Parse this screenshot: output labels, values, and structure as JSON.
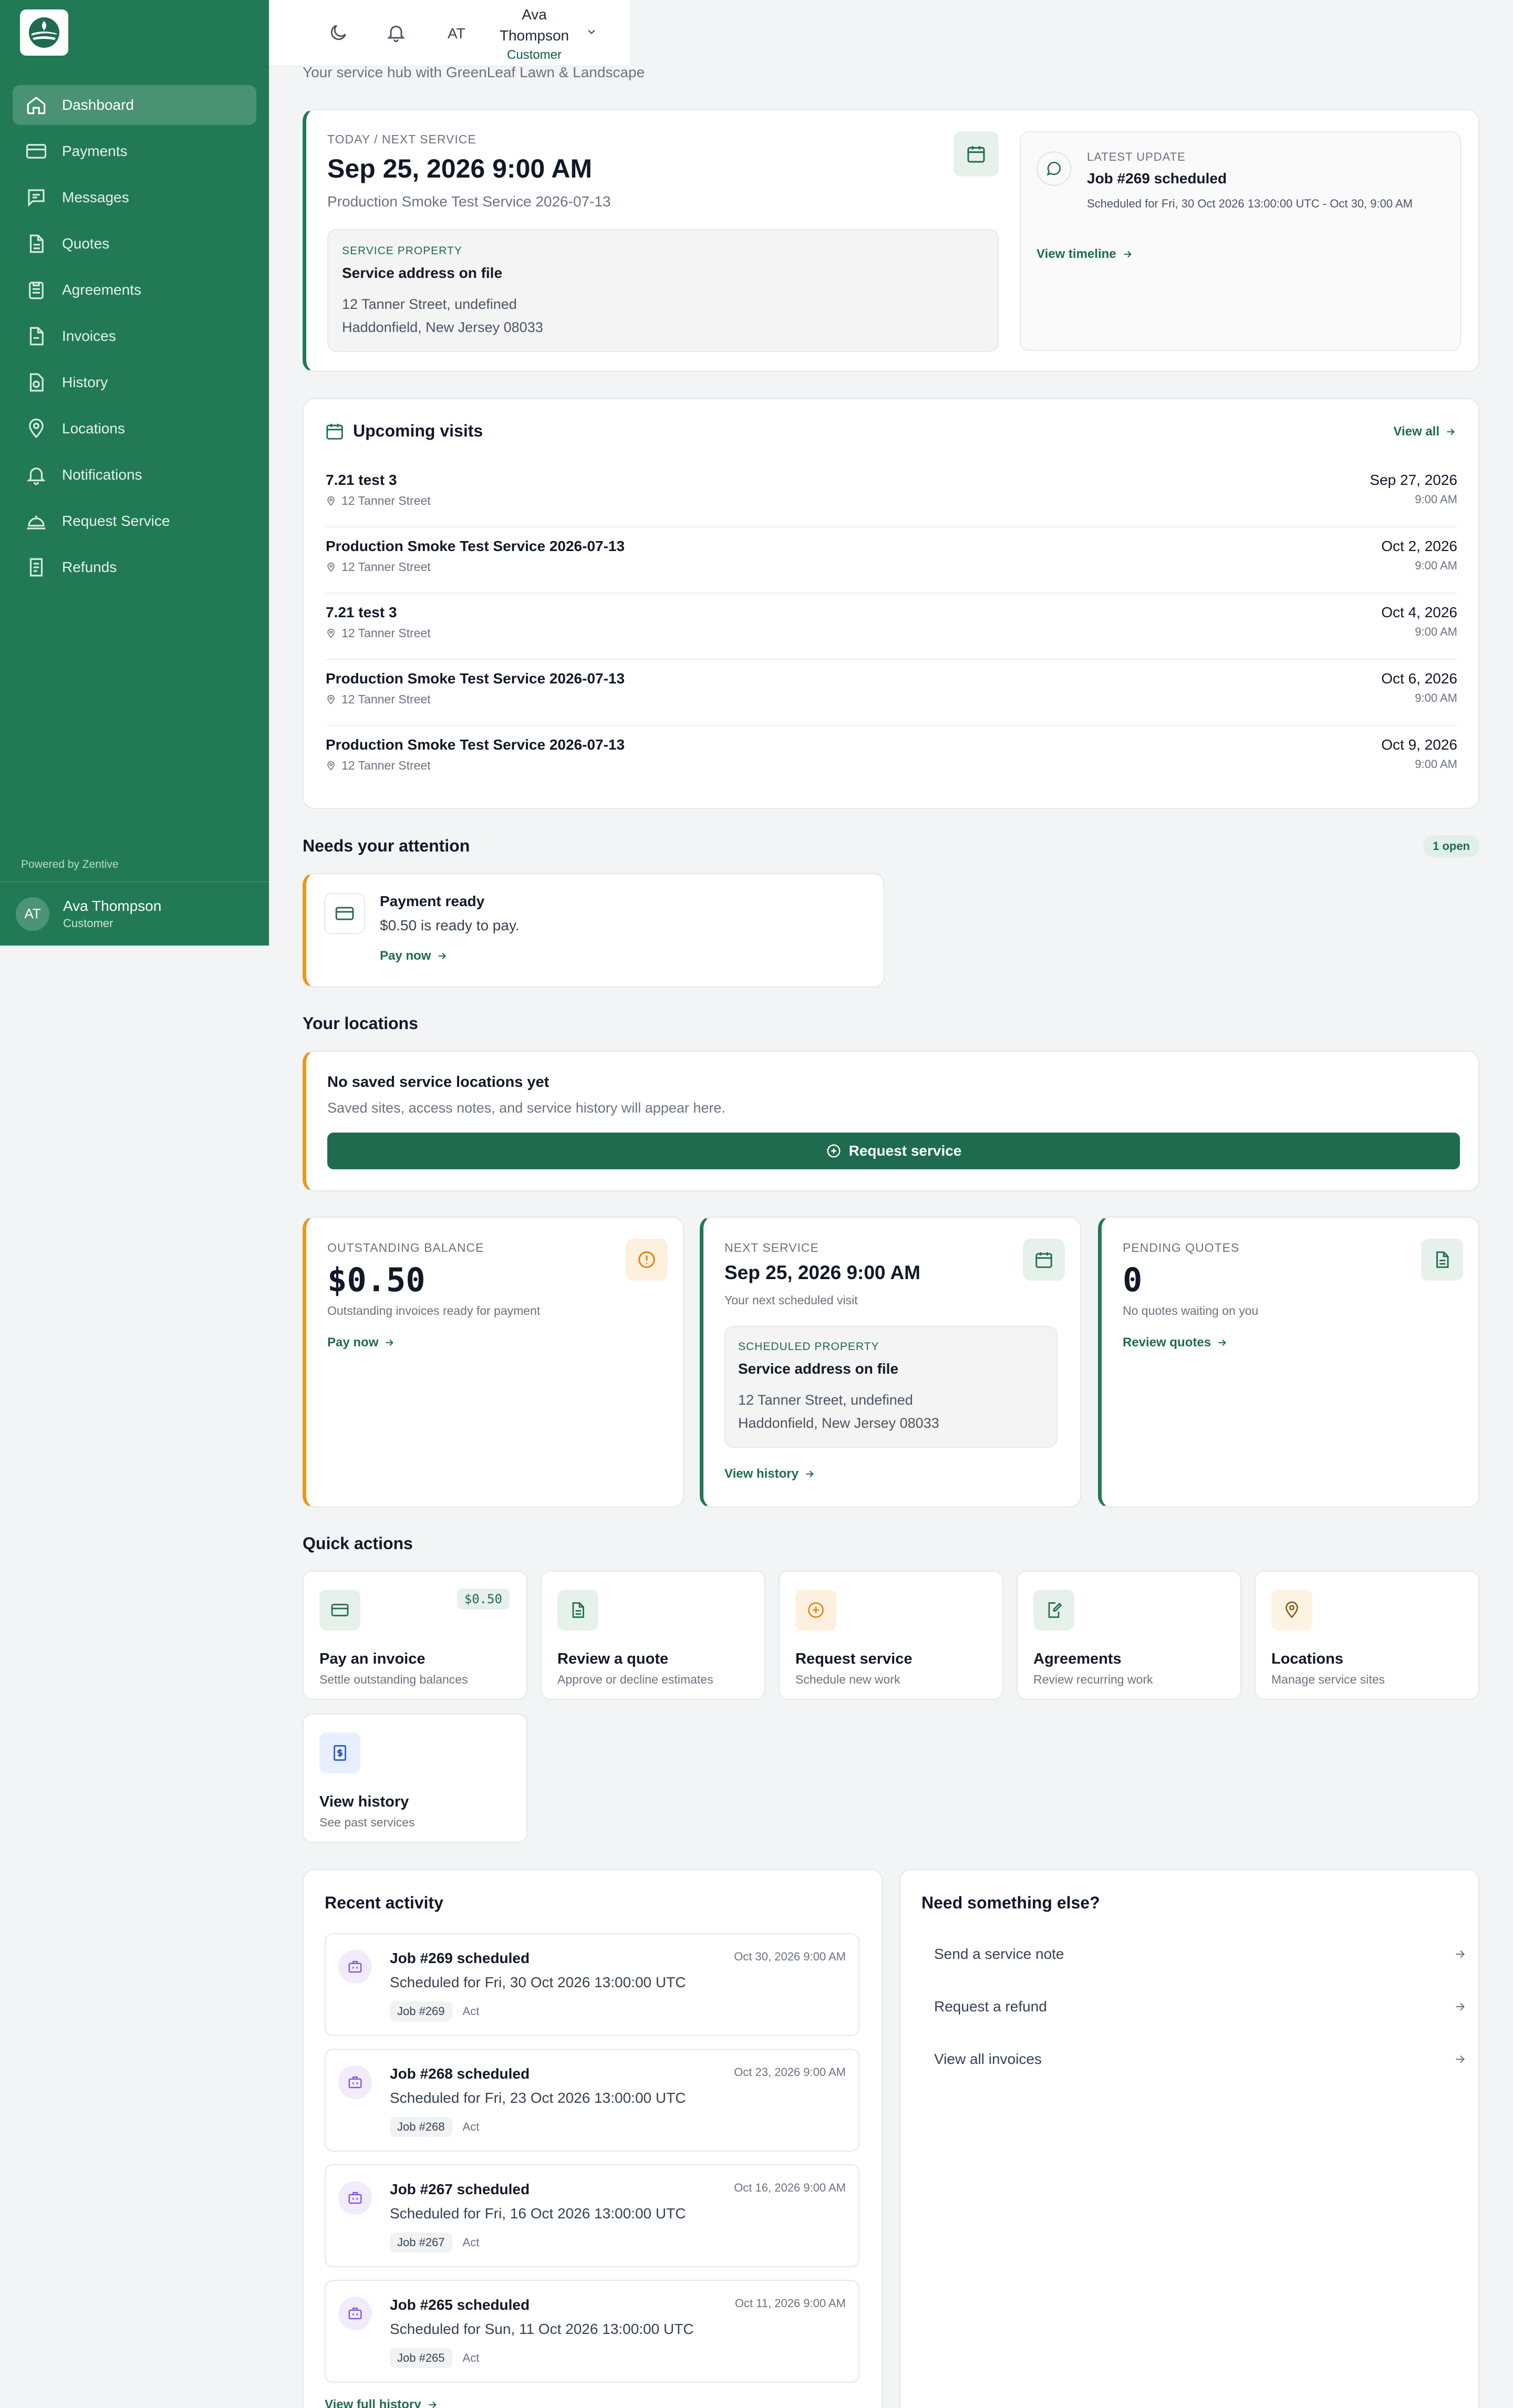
{
  "sidebar": {
    "items": [
      {
        "label": "Dashboard",
        "icon": "home-icon",
        "active": true
      },
      {
        "label": "Payments",
        "icon": "credit-card-icon"
      },
      {
        "label": "Messages",
        "icon": "message-icon"
      },
      {
        "label": "Quotes",
        "icon": "document-icon"
      },
      {
        "label": "Agreements",
        "icon": "clipboard-icon"
      },
      {
        "label": "Invoices",
        "icon": "invoice-icon"
      },
      {
        "label": "History",
        "icon": "history-icon"
      },
      {
        "label": "Locations",
        "icon": "map-pin-icon"
      },
      {
        "label": "Notifications",
        "icon": "bell-icon"
      },
      {
        "label": "Request Service",
        "icon": "bell-service-icon"
      },
      {
        "label": "Refunds",
        "icon": "refund-icon"
      }
    ],
    "powered_by": "Powered by Zentive",
    "user": {
      "initials": "AT",
      "name": "Ava Thompson",
      "role": "Customer"
    }
  },
  "header": {
    "initials": "AT",
    "name_line1": "Ava",
    "name_line2": "Thompson",
    "role": "Customer"
  },
  "subtitle": "Your service hub with GreenLeaf Lawn & Landscape",
  "hero": {
    "label": "TODAY / NEXT SERVICE",
    "datetime": "Sep 25, 2026 9:00 AM",
    "service": "Production Smoke Test Service 2026-07-13",
    "property_label": "SERVICE PROPERTY",
    "property_title": "Service address on file",
    "address_line1": "12 Tanner Street, undefined",
    "address_line2": "Haddonfield, New Jersey 08033",
    "update_label": "LATEST UPDATE",
    "update_title": "Job #269 scheduled",
    "update_desc": "Scheduled for Fri, 30 Oct 2026 13:00:00 UTC - Oct 30, 9:00 AM",
    "update_link": "View timeline"
  },
  "upcoming": {
    "title": "Upcoming visits",
    "view_all": "View all",
    "visits": [
      {
        "title": "7.21 test 3",
        "address": "12 Tanner Street",
        "date": "Sep 27, 2026",
        "time": "9:00 AM"
      },
      {
        "title": "Production Smoke Test Service 2026-07-13",
        "address": "12 Tanner Street",
        "date": "Oct 2, 2026",
        "time": "9:00 AM"
      },
      {
        "title": "7.21 test 3",
        "address": "12 Tanner Street",
        "date": "Oct 4, 2026",
        "time": "9:00 AM"
      },
      {
        "title": "Production Smoke Test Service 2026-07-13",
        "address": "12 Tanner Street",
        "date": "Oct 6, 2026",
        "time": "9:00 AM"
      },
      {
        "title": "Production Smoke Test Service 2026-07-13",
        "address": "12 Tanner Street",
        "date": "Oct 9, 2026",
        "time": "9:00 AM"
      }
    ]
  },
  "attention": {
    "title": "Needs your attention",
    "badge": "1 open",
    "item_title": "Payment ready",
    "item_desc": "$0.50 is ready to pay.",
    "item_link": "Pay now"
  },
  "locations": {
    "title": "Your locations",
    "empty_title": "No saved service locations yet",
    "empty_desc": "Saved sites, access notes, and service history will appear here.",
    "button": "Request service"
  },
  "stats": {
    "balance": {
      "label": "OUTSTANDING BALANCE",
      "value": "$0.50",
      "desc": "Outstanding invoices ready for payment",
      "link": "Pay now"
    },
    "next": {
      "label": "NEXT SERVICE",
      "value": "Sep 25, 2026 9:00 AM",
      "desc": "Your next scheduled visit",
      "prop_label": "SCHEDULED PROPERTY",
      "prop_title": "Service address on file",
      "address_line1": "12 Tanner Street, undefined",
      "address_line2": "Haddonfield, New Jersey 08033",
      "link": "View history"
    },
    "quotes": {
      "label": "PENDING QUOTES",
      "value": "0",
      "desc": "No quotes waiting on you",
      "link": "Review quotes"
    }
  },
  "quick_actions": {
    "title": "Quick actions",
    "items": [
      {
        "title": "Pay an invoice",
        "sub": "Settle outstanding balances",
        "badge": "$0.50",
        "icon": "credit-card-icon"
      },
      {
        "title": "Review a quote",
        "sub": "Approve or decline estimates",
        "icon": "document-icon"
      },
      {
        "title": "Request service",
        "sub": "Schedule new work",
        "icon": "plus-circle-icon"
      },
      {
        "title": "Agreements",
        "sub": "Review recurring work",
        "icon": "edit-document-icon"
      },
      {
        "title": "Locations",
        "sub": "Manage service sites",
        "icon": "map-pin-icon"
      },
      {
        "title": "View history",
        "sub": "See past services",
        "icon": "receipt-icon"
      }
    ]
  },
  "activity": {
    "title": "Recent activity",
    "items": [
      {
        "title": "Job #269 scheduled",
        "date": "Oct 30, 2026 9:00 AM",
        "desc": "Scheduled for Fri, 30 Oct 2026 13:00:00 UTC",
        "tag": "Job #269",
        "extra": "Act"
      },
      {
        "title": "Job #268 scheduled",
        "date": "Oct 23, 2026 9:00 AM",
        "desc": "Scheduled for Fri, 23 Oct 2026 13:00:00 UTC",
        "tag": "Job #268",
        "extra": "Act"
      },
      {
        "title": "Job #267 scheduled",
        "date": "Oct 16, 2026 9:00 AM",
        "desc": "Scheduled for Fri, 16 Oct 2026 13:00:00 UTC",
        "tag": "Job #267",
        "extra": "Act"
      },
      {
        "title": "Job #265 scheduled",
        "date": "Oct 11, 2026 9:00 AM",
        "desc": "Scheduled for Sun, 11 Oct 2026 13:00:00 UTC",
        "tag": "Job #265",
        "extra": "Act"
      }
    ],
    "full_link": "View full history"
  },
  "else": {
    "title": "Need something else?",
    "items": [
      {
        "label": "Send a service note"
      },
      {
        "label": "Request a refund"
      },
      {
        "label": "View all invoices"
      }
    ]
  },
  "colors": {
    "brand": "#217a55",
    "accent_orange": "#e59a1e",
    "background": "#f3f4f6"
  }
}
